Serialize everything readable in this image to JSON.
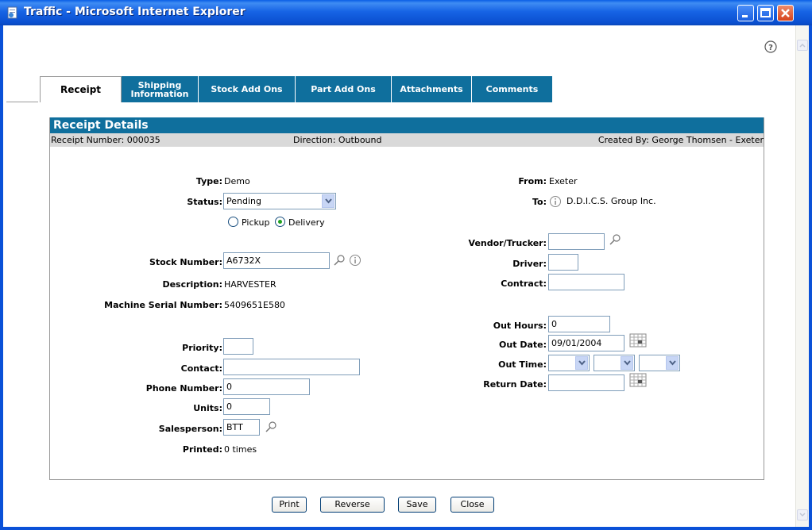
{
  "window": {
    "title": "Traffic - Microsoft Internet Explorer"
  },
  "tabs": [
    {
      "label": "Receipt"
    },
    {
      "label": "Shipping Information"
    },
    {
      "label": "Stock Add Ons"
    },
    {
      "label": "Part Add Ons"
    },
    {
      "label": "Attachments"
    },
    {
      "label": "Comments"
    }
  ],
  "panel": {
    "title": "Receipt Details",
    "receipt_number": "Receipt Number: 000035",
    "direction": "Direction: Outbound",
    "created_by": "Created By: George Thomsen -  Exeter"
  },
  "left": {
    "type_label": "Type:",
    "type_value": "Demo",
    "status_label": "Status:",
    "status_value": "Pending",
    "pickup_label": "Pickup",
    "delivery_label": "Delivery",
    "selected_option": "Delivery",
    "stock_label": "Stock Number:",
    "stock_value": "A6732X",
    "description_label": "Description:",
    "description_value": "HARVESTER",
    "serial_label": "Machine Serial Number:",
    "serial_value": "5409651E580",
    "priority_label": "Priority:",
    "priority_value": "",
    "contact_label": "Contact:",
    "contact_value": "",
    "phone_label": "Phone Number:",
    "phone_value": "0",
    "units_label": "Units:",
    "units_value": "0",
    "salesperson_label": "Salesperson:",
    "salesperson_value": "BTT",
    "printed_label": "Printed:",
    "printed_value": "0 times"
  },
  "right": {
    "from_label": "From:",
    "from_value": "Exeter",
    "to_label": "To:",
    "to_value": "D.D.I.C.S. Group Inc.",
    "vendor_label": "Vendor/Trucker:",
    "vendor_value": "",
    "driver_label": "Driver:",
    "driver_value": "",
    "contract_label": "Contract:",
    "contract_value": "",
    "out_hours_label": "Out Hours:",
    "out_hours_value": "0",
    "out_date_label": "Out Date:",
    "out_date_value": "09/01/2004",
    "out_time_label": "Out Time:",
    "return_date_label": "Return Date:",
    "return_date_value": ""
  },
  "buttons": {
    "print": "Print",
    "reverse": "Reverse",
    "save": "Save",
    "close": "Close"
  }
}
